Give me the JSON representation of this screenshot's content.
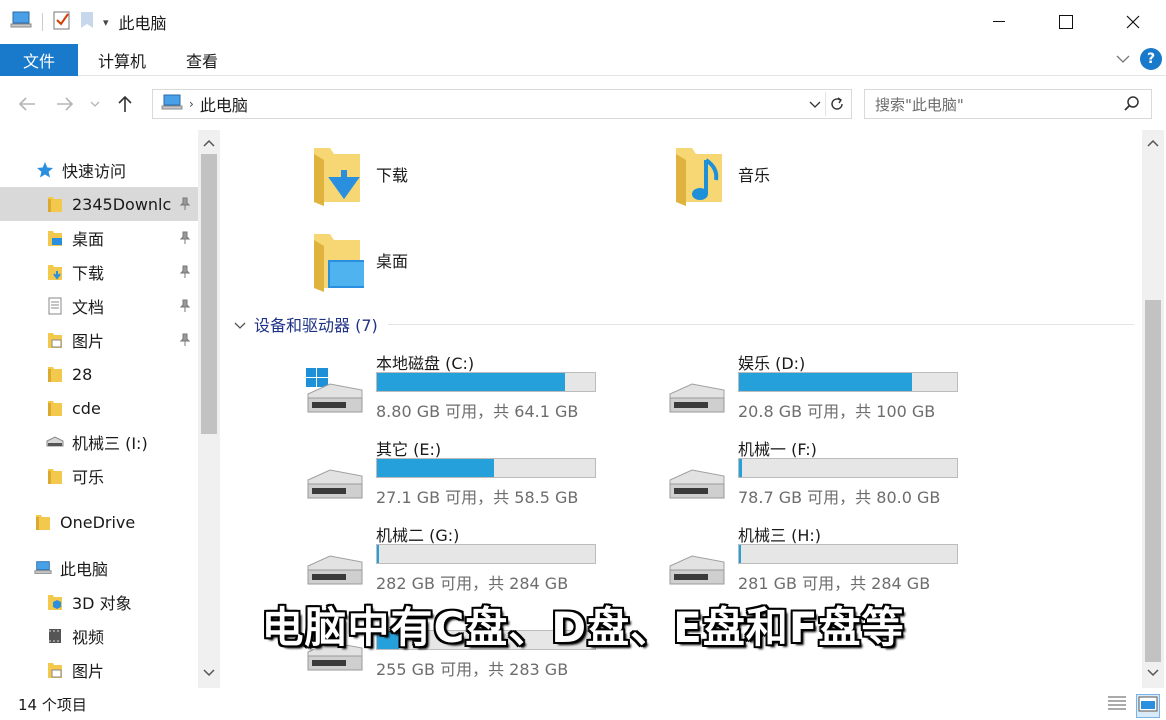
{
  "window": {
    "title": "此电脑"
  },
  "ribbon": {
    "tabs": [
      "文件",
      "计算机",
      "查看"
    ]
  },
  "address": {
    "path": "此电脑",
    "search_placeholder": "搜索\"此电脑\""
  },
  "sidebar": {
    "items": [
      {
        "label": "快速访问",
        "icon": "star-icon"
      },
      {
        "label": "2345Downlc",
        "icon": "folder-icon"
      },
      {
        "label": "桌面",
        "icon": "desktop-folder-icon"
      },
      {
        "label": "下载",
        "icon": "downloads-folder-icon"
      },
      {
        "label": "文档",
        "icon": "documents-folder-icon"
      },
      {
        "label": "图片",
        "icon": "pictures-folder-icon"
      },
      {
        "label": "28",
        "icon": "folder-icon"
      },
      {
        "label": "cde",
        "icon": "folder-icon"
      },
      {
        "label": "机械三 (I:)",
        "icon": "drive-icon"
      },
      {
        "label": "可乐",
        "icon": "folder-icon"
      },
      {
        "label": "OneDrive",
        "icon": "folder-icon"
      },
      {
        "label": "此电脑",
        "icon": "computer-icon"
      },
      {
        "label": "3D 对象",
        "icon": "3d-objects-icon"
      },
      {
        "label": "视频",
        "icon": "videos-icon"
      },
      {
        "label": "图片",
        "icon": "pictures-folder-icon"
      }
    ]
  },
  "folders": [
    {
      "label": "下载",
      "icon": "downloads-folder-icon"
    },
    {
      "label": "音乐",
      "icon": "music-folder-icon"
    },
    {
      "label": "桌面",
      "icon": "desktop-folder-icon"
    }
  ],
  "devices": {
    "header": "设备和驱动器 (7)",
    "drives": [
      {
        "name": "本地磁盘 (C:)",
        "free": "8.80 GB 可用，共 64.1 GB",
        "used_fraction": 0.863,
        "icon": "windows-drive-icon"
      },
      {
        "name": "娱乐 (D:)",
        "free": "20.8 GB 可用，共 100 GB",
        "used_fraction": 0.792,
        "icon": "drive-icon"
      },
      {
        "name": "其它 (E:)",
        "free": "27.1 GB 可用，共 58.5 GB",
        "used_fraction": 0.537,
        "icon": "drive-icon"
      },
      {
        "name": "机械一 (F:)",
        "free": "78.7 GB 可用，共 80.0 GB",
        "used_fraction": 0.016,
        "icon": "drive-icon"
      },
      {
        "name": "机械二 (G:)",
        "free": "282 GB 可用，共 284 GB",
        "used_fraction": 0.007,
        "icon": "drive-icon"
      },
      {
        "name": "机械三 (H:)",
        "free": "281 GB 可用，共 284 GB",
        "used_fraction": 0.011,
        "icon": "drive-icon"
      },
      {
        "name": "",
        "free": "255 GB 可用，共 283 GB",
        "used_fraction": 0.099,
        "icon": "drive-icon"
      }
    ]
  },
  "status": {
    "item_count": "14 个项目"
  },
  "subtitle": "电脑中有C盘、D盘、E盘和F盘等",
  "colors": {
    "accent": "#1979ca",
    "bar_fill": "#26a0da",
    "group_header": "#1e3287"
  }
}
